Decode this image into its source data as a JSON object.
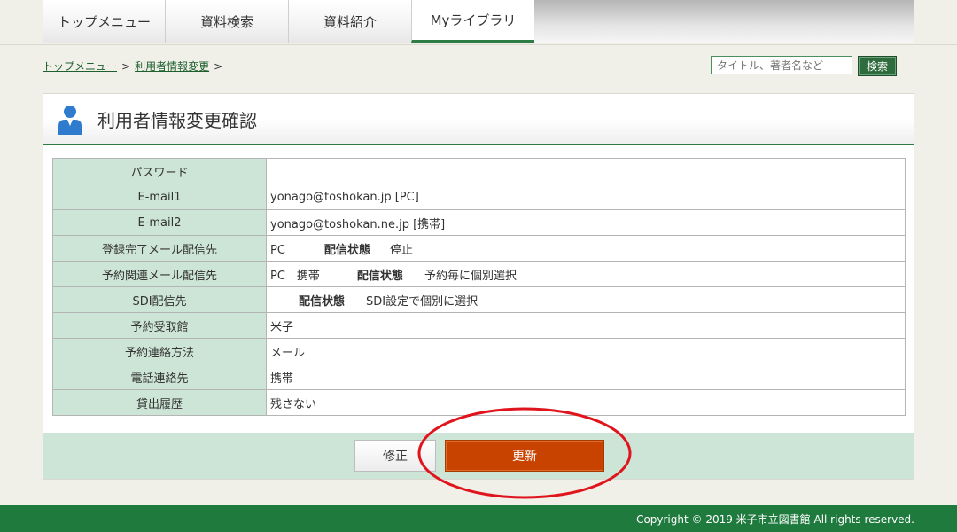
{
  "nav": {
    "tabs": [
      {
        "label": "トップメニュー"
      },
      {
        "label": "資料検索"
      },
      {
        "label": "資料紹介"
      },
      {
        "label": "Myライブラリ"
      }
    ]
  },
  "breadcrumb": {
    "items": [
      "トップメニュー",
      "利用者情報変更"
    ],
    "separator": ">"
  },
  "search": {
    "placeholder": "タイトル、著者名など",
    "button_label": "検索"
  },
  "page": {
    "title": "利用者情報変更確認"
  },
  "info": {
    "rows": [
      {
        "label": "パスワード",
        "value": ""
      },
      {
        "label": "E-mail1",
        "value": "yonago@toshokan.jp [PC]"
      },
      {
        "label": "E-mail2",
        "value": "yonago@toshokan.ne.jp [携帯]"
      },
      {
        "label": "登録完了メール配信先",
        "value": "PC",
        "status_label": "配信状態",
        "status_value": "停止"
      },
      {
        "label": "予約関連メール配信先",
        "value": "PC　携帯",
        "status_label": "配信状態",
        "status_value": "予約毎に個別選択"
      },
      {
        "label": "SDI配信先",
        "value": "",
        "status_label": "配信状態",
        "status_value": "SDI設定で個別に選択"
      },
      {
        "label": "予約受取館",
        "value": "米子"
      },
      {
        "label": "予約連絡方法",
        "value": "メール"
      },
      {
        "label": "電話連絡先",
        "value": "携帯"
      },
      {
        "label": "貸出履歴",
        "value": "残さない"
      }
    ]
  },
  "buttons": {
    "edit_label": "修正",
    "update_label": "更新"
  },
  "footer": {
    "copyright": "Copyright © 2019 米子市立図書館 All rights reserved."
  },
  "colors": {
    "brand_green": "#1f7a3d",
    "label_bg": "#cde5d6",
    "update_button": "#c84300",
    "annotation_red": "#e0141c"
  }
}
